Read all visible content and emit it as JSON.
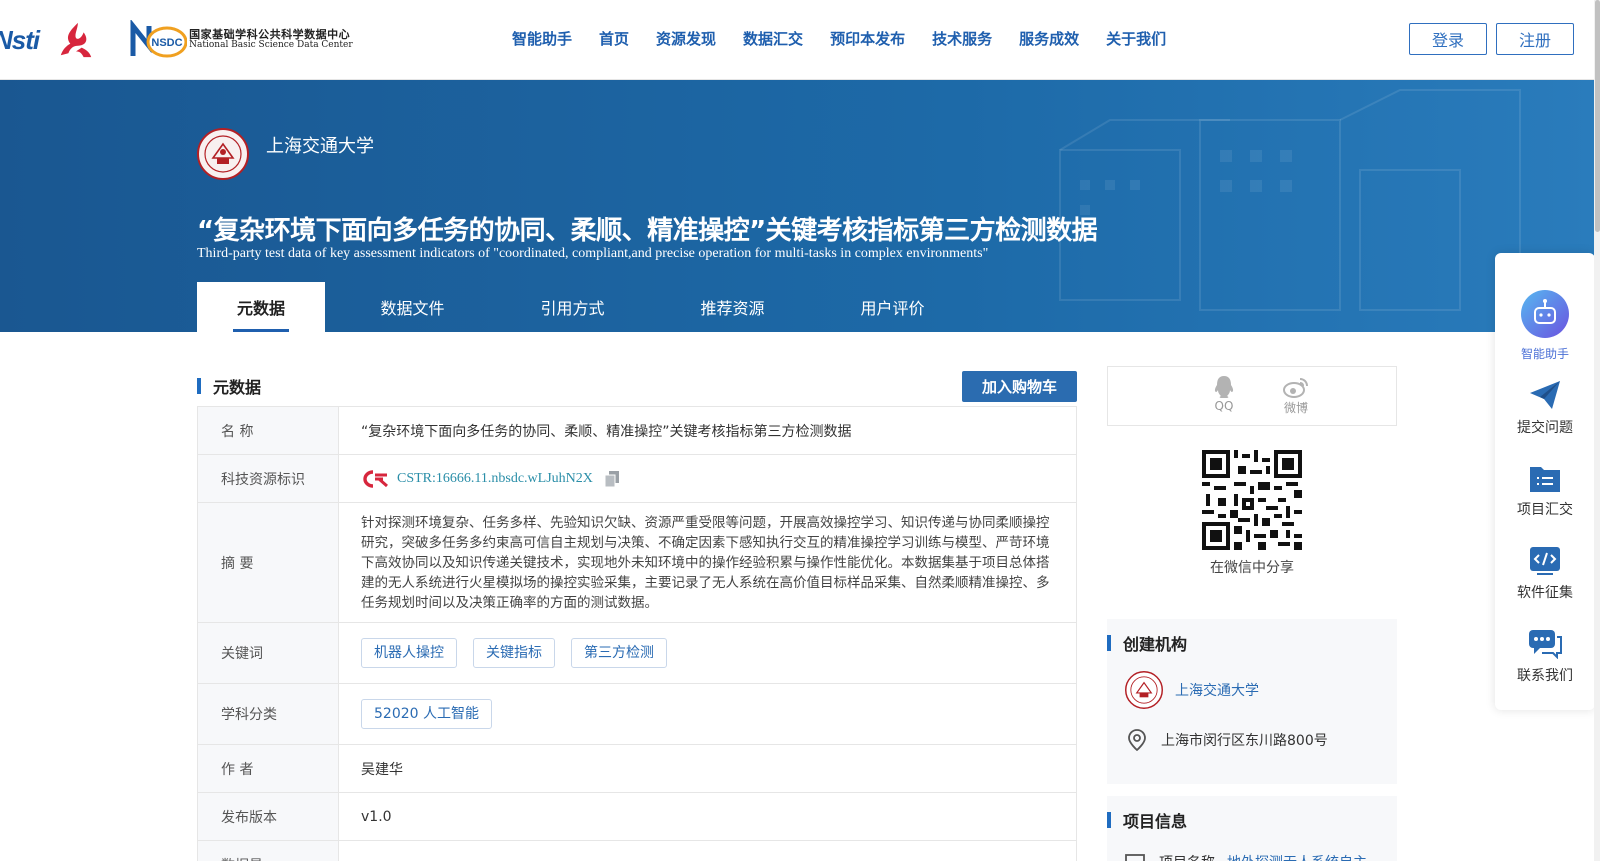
{
  "header": {
    "logo_cstr": "Nsti",
    "logo_nsdc_badge": "NSDC",
    "logo_nsdc_cn": "国家基础学科公共科学数据中心",
    "logo_nsdc_en": "National Basic Science Data Center",
    "nav": [
      "智能助手",
      "首页",
      "资源发现",
      "数据汇交",
      "预印本发布",
      "技术服务",
      "服务成效",
      "关于我们"
    ],
    "login": "登录",
    "register": "注册"
  },
  "banner": {
    "institution": "上海交通大学",
    "title_cn": "“复杂环境下面向多任务的协同、柔顺、精准操控”关键考核指标第三方检测数据",
    "title_en": "Third-party test data of key assessment indicators of \"coordinated, compliant,and precise operation for multi-tasks in complex environments\"",
    "tabs": [
      "元数据",
      "数据文件",
      "引用方式",
      "推荐资源",
      "用户评价"
    ]
  },
  "metadata": {
    "section_title": "元数据",
    "cart_button": "加入购物车",
    "rows": {
      "name_label": "名 称",
      "name_value": "“复杂环境下面向多任务的协同、柔顺、精准操控”关键考核指标第三方检测数据",
      "id_label": "科技资源标识",
      "id_value": "CSTR:16666.11.nbsdc.wLJuhN2X",
      "abstract_label": "摘 要",
      "abstract_value": "针对探测环境复杂、任务多样、先验知识欠缺、资源严重受限等问题，开展高效操控学习、知识传递与协同柔顺操控研究，突破多任务多约束高可信自主规划与决策、不确定因素下感知执行交互的精准操控学习训练与模型、严苛环境下高效协同以及知识传递关键技术，实现地外未知环境中的操作经验积累与操作性能优化。本数据集基于项目总体搭建的无人系统进行火星模拟场的操控实验采集，主要记录了无人系统在高价值目标样品采集、自然柔顺精准操控、多任务规划时间以及决策正确率的方面的测试数据。",
      "keywords_label": "关键词",
      "keywords": [
        "机器人操控",
        "关键指标",
        "第三方检测"
      ],
      "subject_label": "学科分类",
      "subject": "52020 人工智能",
      "author_label": "作 者",
      "author_value": "吴建华",
      "version_label": "发布版本",
      "version_value": "v1.0",
      "size_label": "数据量"
    }
  },
  "sidebar": {
    "share_qq": "QQ",
    "share_weibo": "微博",
    "qr_caption": "在微信中分享",
    "creator_title": "创建机构",
    "creator_name": "上海交通大学",
    "creator_address": "上海市闵行区东川路800号",
    "project_title": "项目信息",
    "project_name_label": "项目名称",
    "project_name_value": "地外探测无人系统自主"
  },
  "float_panel": {
    "assistant": "智能助手",
    "submit": "提交问题",
    "projects": "项目汇交",
    "software": "软件征集",
    "contact": "联系我们"
  },
  "colors": {
    "brand_blue": "#1f5fae",
    "banner_blue": "#1d6aa8",
    "link_teal": "#2a8ea8",
    "cstr_red": "#d7263d"
  }
}
